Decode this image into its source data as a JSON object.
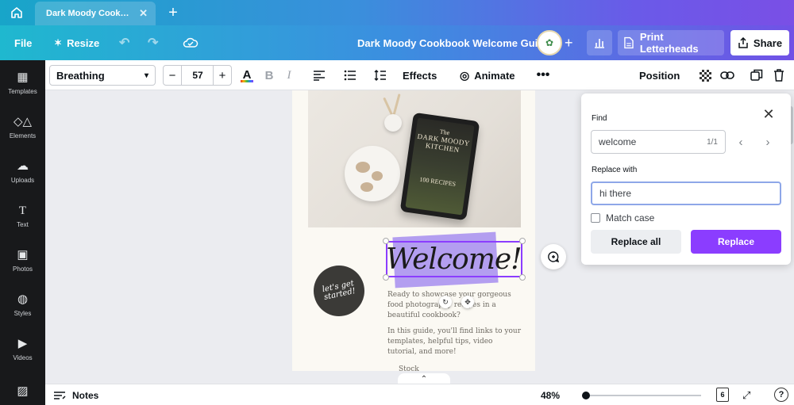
{
  "browser": {
    "tab_title": "Dark Moody Cookboo...",
    "tab_close": "✕",
    "new_tab": "+"
  },
  "header": {
    "file": "File",
    "resize": "Resize",
    "title": "Dark Moody Cookbook Welcome Guide",
    "plus": "+",
    "print_label": "Print Letterheads",
    "share_label": "Share"
  },
  "sidebar": {
    "items": [
      {
        "label": "Templates",
        "icon": "templates-icon"
      },
      {
        "label": "Elements",
        "icon": "elements-icon"
      },
      {
        "label": "Uploads",
        "icon": "uploads-icon"
      },
      {
        "label": "Text",
        "icon": "text-icon"
      },
      {
        "label": "Photos",
        "icon": "photos-icon"
      },
      {
        "label": "Styles",
        "icon": "styles-icon"
      },
      {
        "label": "Videos",
        "icon": "videos-icon"
      },
      {
        "label": "",
        "icon": "pattern-icon"
      }
    ]
  },
  "toolbar": {
    "font": "Breathing",
    "font_size": "57",
    "minus": "−",
    "plus": "+",
    "color_letter": "A",
    "bold": "B",
    "italic": "I",
    "effects": "Effects",
    "animate": "Animate",
    "more": "•••",
    "position": "Position"
  },
  "canvas": {
    "tablet_title_small": "The",
    "tablet_title": "DARK MOODY KITCHEN",
    "tablet_recipes": "100 RECIPES",
    "badge": "let's get started!",
    "welcome": "Welcome!",
    "paragraph1": "Ready to showcase your gorgeous food photography recipes in a beautiful cookbook?",
    "paragraph2": "In this guide, you'll find links to your templates, helpful tips, video tutorial, and more!",
    "cut_text": "Stock"
  },
  "find_replace": {
    "find_label": "Find",
    "find_value": "welcome",
    "match_count": "1/1",
    "replace_label": "Replace with",
    "replace_value": "hi there",
    "match_case_label": "Match case",
    "replace_all_label": "Replace all",
    "replace_label_btn": "Replace"
  },
  "footer": {
    "notes": "Notes",
    "zoom": "48%",
    "page_count": "6",
    "help": "?"
  },
  "colors": {
    "accent": "#8b3dff",
    "header_start": "#1fb8cf",
    "header_end": "#7152e6",
    "sidebar": "#18191b"
  }
}
